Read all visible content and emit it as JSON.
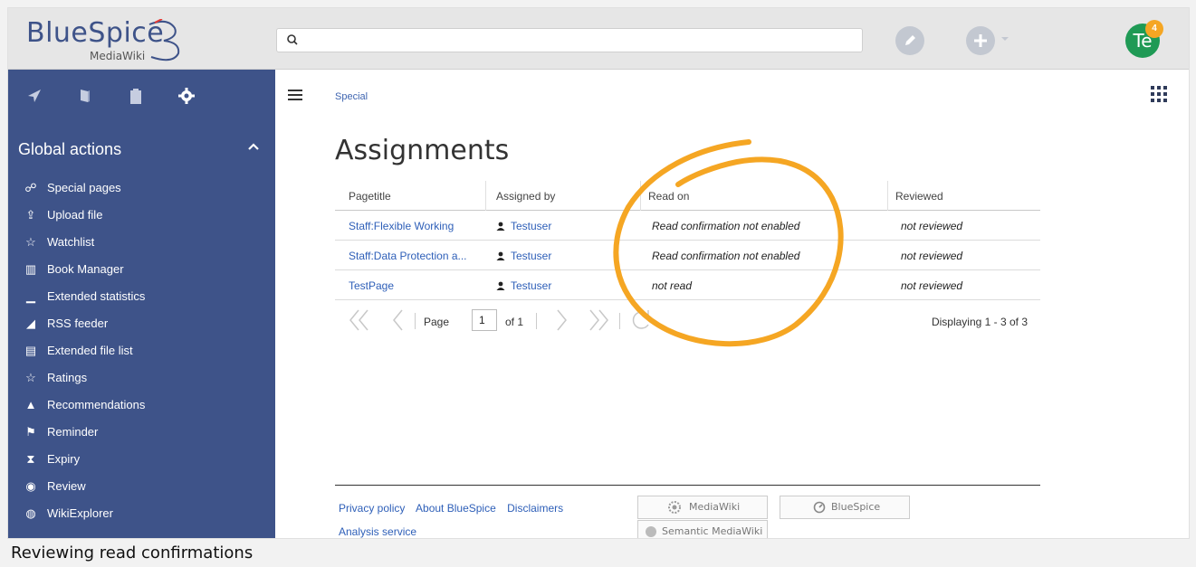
{
  "logo": {
    "word": "BlueSpice",
    "sub": "MediaWiki"
  },
  "topbar": {
    "avatar_initials": "Te",
    "notification_count": "4"
  },
  "sidebar": {
    "heading": "Global actions",
    "items": [
      {
        "label": "Special pages",
        "icon": "special-pages-icon",
        "glyph": "☍"
      },
      {
        "label": "Upload file",
        "icon": "upload-icon",
        "glyph": "⇪"
      },
      {
        "label": "Watchlist",
        "icon": "star-icon",
        "glyph": "☆"
      },
      {
        "label": "Book Manager",
        "icon": "books-icon",
        "glyph": "▥"
      },
      {
        "label": "Extended statistics",
        "icon": "statistics-icon",
        "glyph": "▁"
      },
      {
        "label": "RSS feeder",
        "icon": "rss-icon",
        "glyph": "◢"
      },
      {
        "label": "Extended file list",
        "icon": "file-list-icon",
        "glyph": "▤"
      },
      {
        "label": "Ratings",
        "icon": "star-outline-icon",
        "glyph": "☆"
      },
      {
        "label": "Recommendations",
        "icon": "flame-icon",
        "glyph": "▲"
      },
      {
        "label": "Reminder",
        "icon": "flag-icon",
        "glyph": "⚑"
      },
      {
        "label": "Expiry",
        "icon": "hourglass-icon",
        "glyph": "⧗"
      },
      {
        "label": "Review",
        "icon": "eye-icon",
        "glyph": "◉"
      },
      {
        "label": "WikiExplorer",
        "icon": "globe-icon",
        "glyph": "◍"
      }
    ]
  },
  "breadcrumb": "Special",
  "page_title": "Assignments",
  "table": {
    "headers": [
      "Pagetitle",
      "Assigned by",
      "Read on",
      "Reviewed"
    ],
    "rows": [
      {
        "page": "Staff:Flexible Working",
        "assigned_by": "Testuser",
        "read_on": "Read confirmation not enabled",
        "reviewed": "not reviewed"
      },
      {
        "page": "Staff:Data Protection a...",
        "assigned_by": "Testuser",
        "read_on": "Read confirmation not enabled",
        "reviewed": "not reviewed"
      },
      {
        "page": "TestPage",
        "assigned_by": "Testuser",
        "read_on": "not read",
        "reviewed": "not reviewed"
      }
    ]
  },
  "pager": {
    "page_label": "Page",
    "page_value": "1",
    "of_label": "of 1",
    "displaying": "Displaying 1 - 3 of 3"
  },
  "footer": {
    "links": [
      "Privacy policy",
      "About BlueSpice",
      "Disclaimers"
    ],
    "analysis": "Analysis service",
    "badges": [
      "MediaWiki",
      "BlueSpice",
      "Semantic MediaWiki"
    ]
  },
  "caption": "Reviewing read confirmations",
  "colors": {
    "sidebar": "#3e5389",
    "accent_link": "#2e5fb8",
    "annotation": "#f5a623"
  }
}
